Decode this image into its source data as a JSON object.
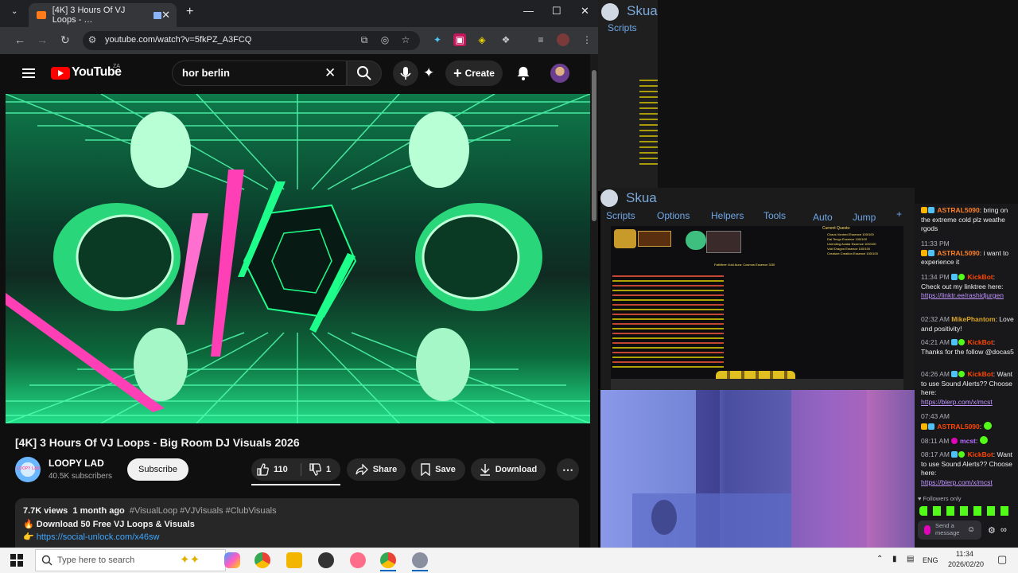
{
  "browser": {
    "tab_title": "[4K] 3 Hours Of VJ Loops - …",
    "new_tab": "+",
    "url": "youtube.com/watch?v=5fkPZ_A3FCQ",
    "window_controls": [
      "—",
      "☐",
      "✕"
    ]
  },
  "youtube": {
    "logo_text": "YouTube",
    "country": "ZA",
    "search_value": "hor berlin",
    "create_label": "Create",
    "video_title": "[4K] 3 Hours Of VJ Loops - Big Room DJ Visuals 2026",
    "channel_name": "LOOPY LAD",
    "channel_subs": "40.5K subscribers",
    "channel_avatar_text": "LOOPY LAD",
    "subscribe_label": "Subscribe",
    "likes": "110",
    "dislikes": "1",
    "share_label": "Share",
    "save_label": "Save",
    "download_label": "Download",
    "description": {
      "views": "7.7K views",
      "age": "1 month ago",
      "tags": "#VisualLoop #VJVisuals #ClubVisuals",
      "line2": "🔥 Download 50 Free VJ Loops & Visuals",
      "line3_prefix": "👉",
      "line3_link": "https://social-unlock.com/x46sw"
    }
  },
  "skua_top": {
    "title": "Skua",
    "menu": "Scripts"
  },
  "skua_main": {
    "title": "Skua",
    "menu": [
      "Scripts",
      "Options",
      "Helpers",
      "Tools",
      "Auto",
      "Jump",
      "+"
    ],
    "quest_header": "Current Quests:",
    "quests": [
      "Chaos Vordred Essence 100/100",
      "Dai Tengu Essence 100/100",
      "Unending Avatar Essence 100/100",
      "Void Dragon Essence 100/100",
      "Creature Creation Essence 100/100"
    ],
    "aura_text": "Faithfree Void Aura: Cosmos Essence 3/30"
  },
  "chat": {
    "messages": [
      {
        "user": "ASTRAL5090",
        "text": ": bring on the extreme cold plz weathe rgods"
      },
      {
        "time": "11:33 PM",
        "user": "ASTRAL5090",
        "text": ": i want to experience it"
      },
      {
        "time": "11:34 PM",
        "user": "KickBot",
        "text": ": Check out my linktree here:",
        "link": "https://linktr.ee/rashidjurgen"
      },
      {
        "time": "02:32 AM",
        "user": "MikePhantom",
        "text": ": Love and positivity!"
      },
      {
        "time": "04:21 AM",
        "user": "KickBot",
        "text": ": Thanks for the follow @docas5"
      },
      {
        "time": "04:26 AM",
        "user": "KickBot",
        "text": ": Want to use Sound Alerts?? Choose here:",
        "link": "https://blerp.com/x/mcst"
      },
      {
        "time": "07:43 AM",
        "user": "ASTRAL5090",
        "text": ":"
      },
      {
        "time": "08:11 AM",
        "user": "mcst",
        "text": ":"
      },
      {
        "time": "08:17 AM",
        "user": "KickBot",
        "text": ": Want to use Sound Alerts?? Choose here:",
        "link": "https://blerp.com/x/mcst"
      }
    ],
    "followers_only": "Followers only",
    "send_placeholder": "Send a message"
  },
  "taskbar": {
    "search_placeholder": "Type here to search",
    "lang": "ENG",
    "time": "11:34",
    "date": "2026/02/20"
  },
  "colors": {
    "accent_link": "#3ea6ff",
    "youtube_red": "#ff0000",
    "chat_link": "#bf94ff"
  }
}
